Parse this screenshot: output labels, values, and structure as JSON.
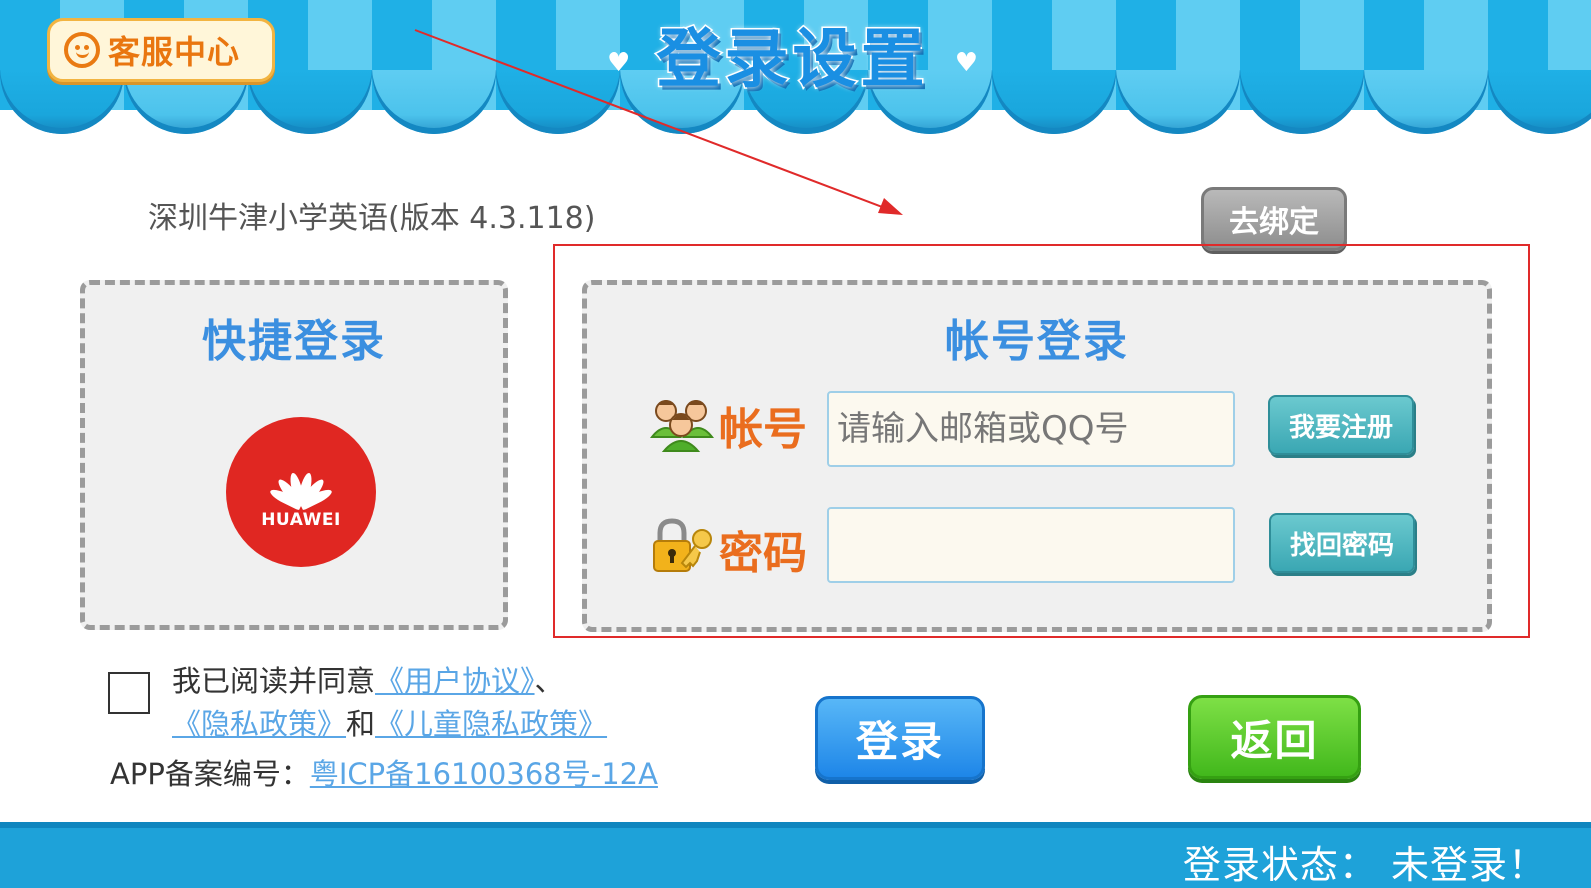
{
  "header": {
    "service_label": "客服中心",
    "title": "登录设置"
  },
  "version_text": "深圳牛津小学英语(版本 4.3.118)",
  "unbind_label": "去绑定",
  "quick_login": {
    "title": "快捷登录",
    "huawei_label": "HUAWEI"
  },
  "account_login": {
    "title": "帐号登录",
    "account_label": "帐号",
    "account_placeholder": "请输入邮箱或QQ号",
    "account_value": "",
    "register_label": "我要注册",
    "password_label": "密码",
    "password_value": "",
    "find_password_label": "找回密码"
  },
  "agreement": {
    "prefix": "我已阅读并同意",
    "user_agreement": "《用户协议》",
    "separator": "、",
    "privacy_policy": "《隐私政策》",
    "and": "和",
    "child_privacy_policy": "《儿童隐私政策》",
    "filing_label": "APP备案编号：",
    "filing_number": "粤ICP备16100368号-12A"
  },
  "buttons": {
    "login": "登录",
    "back": "返回"
  },
  "footer": {
    "status": "登录状态：  未登录！"
  },
  "colors": {
    "awning_dark": "#1fb0e6",
    "awning_light": "#5fcdf2",
    "accent_orange": "#ea6d1e",
    "title_blue": "#3b8fe0",
    "login_blue": "#1e86e8",
    "back_green": "#42b81c",
    "annotation_red": "#e02a2a"
  },
  "icons": [
    "smiley-icon",
    "heart-icon",
    "huawei-logo-icon",
    "users-icon",
    "lock-key-icon",
    "annotation-arrow-icon"
  ]
}
